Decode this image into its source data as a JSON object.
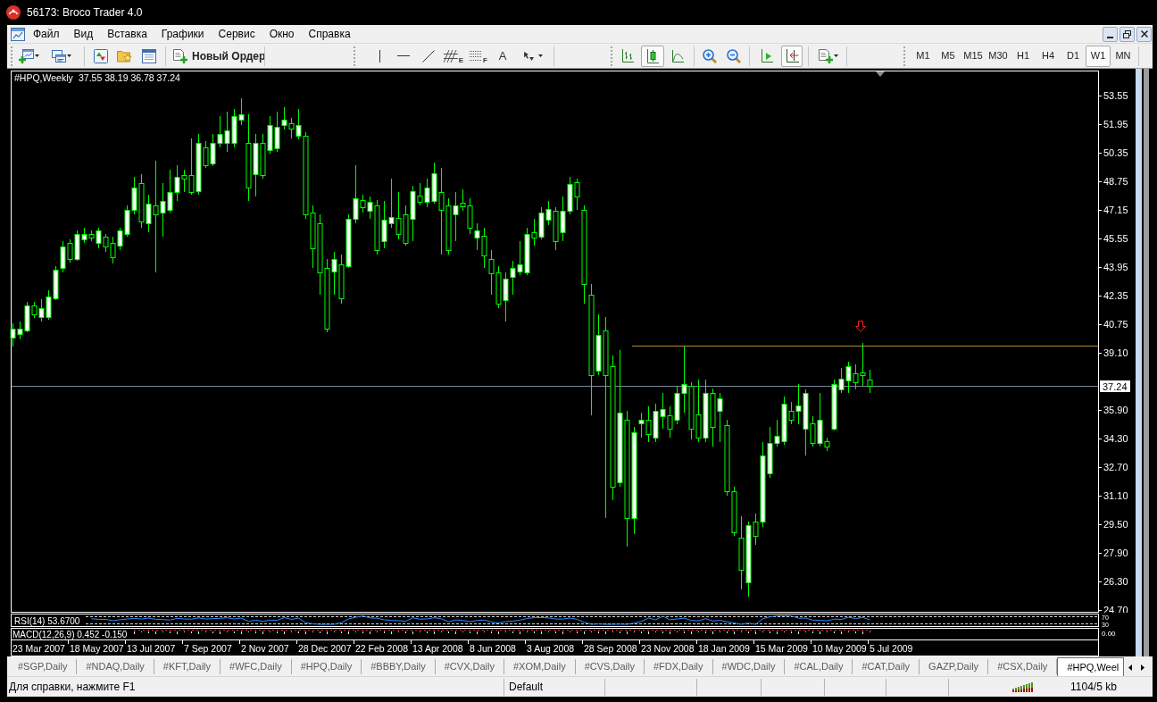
{
  "window": {
    "title": "56173: Broco Trader 4.0"
  },
  "menu": [
    "Файл",
    "Вид",
    "Вставка",
    "Графики",
    "Сервис",
    "Окно",
    "Справка"
  ],
  "toolbar": {
    "new_order": "Новый Ордер",
    "channel_mark": "E",
    "fibo_mark": "F",
    "text_tool": "A",
    "chart_types": [
      {
        "kind": "bars",
        "selected": false
      },
      {
        "kind": "candles",
        "selected": true
      },
      {
        "kind": "line",
        "selected": false
      }
    ],
    "autoscroll": {
      "on": false
    },
    "chart_shift": {
      "on": true
    },
    "timeframes": [
      {
        "label": "M1",
        "selected": false
      },
      {
        "label": "M5",
        "selected": false
      },
      {
        "label": "M15",
        "selected": false
      },
      {
        "label": "M30",
        "selected": false
      },
      {
        "label": "H1",
        "selected": false
      },
      {
        "label": "H4",
        "selected": false
      },
      {
        "label": "D1",
        "selected": false
      },
      {
        "label": "W1",
        "selected": true
      },
      {
        "label": "MN",
        "selected": false
      }
    ]
  },
  "chart": {
    "symbol": "#HPQ,Weekly",
    "ohlc": "37.55 38.19 36.78 37.24",
    "price_ticks_upper": [
      "53.55",
      "51.95",
      "50.35",
      "48.75",
      "47.15",
      "45.55",
      "43.95",
      "42.35",
      "40.75",
      "39.10"
    ],
    "price_ticks_lower": [
      "35.90",
      "34.30",
      "32.70",
      "31.10",
      "29.50",
      "27.90",
      "26.30",
      "24.70"
    ],
    "price_tag": "37.24",
    "time_labels": [
      "23 Mar 2007",
      "18 May 2007",
      "13 Jul 2007",
      "7 Sep 2007",
      "2 Nov 2007",
      "28 Dec 2007",
      "22 Feb 2008",
      "13 Apr 2008",
      "8 Jun 2008",
      "3 Aug 2008",
      "28 Sep 2008",
      "23 Nov 2008",
      "18 Jan 2009",
      "15 Mar 2009",
      "10 May 2009",
      "5 Jul 2009"
    ],
    "indicators": [
      {
        "kind": "rsi",
        "label": "RSI(14) 53.6700",
        "scale": [
          "70",
          "30"
        ]
      },
      {
        "kind": "macd",
        "label": "MACD(12,26,9) 0.452 -0.150",
        "scale": [
          "0.00"
        ]
      }
    ]
  },
  "tabs": [
    {
      "label": "#SGP,Daily",
      "selected": false
    },
    {
      "label": "#NDAQ,Daily",
      "selected": false
    },
    {
      "label": "#KFT,Daily",
      "selected": false
    },
    {
      "label": "#WFC,Daily",
      "selected": false
    },
    {
      "label": "#HPQ,Daily",
      "selected": false
    },
    {
      "label": "#BBBY,Daily",
      "selected": false
    },
    {
      "label": "#CVX,Daily",
      "selected": false
    },
    {
      "label": "#XOM,Daily",
      "selected": false
    },
    {
      "label": "#CVS,Daily",
      "selected": false
    },
    {
      "label": "#FDX,Daily",
      "selected": false
    },
    {
      "label": "#WDC,Daily",
      "selected": false
    },
    {
      "label": "#CAL,Daily",
      "selected": false
    },
    {
      "label": "#CAT,Daily",
      "selected": false
    },
    {
      "label": "GAZP,Daily",
      "selected": false
    },
    {
      "label": "#CSX,Daily",
      "selected": false
    },
    {
      "label": "#HPQ,Weel",
      "selected": true
    }
  ],
  "status_bar": {
    "hint": "Для справки, нажмите F1",
    "profile": "Default",
    "traffic": "1104/5 kb"
  }
}
